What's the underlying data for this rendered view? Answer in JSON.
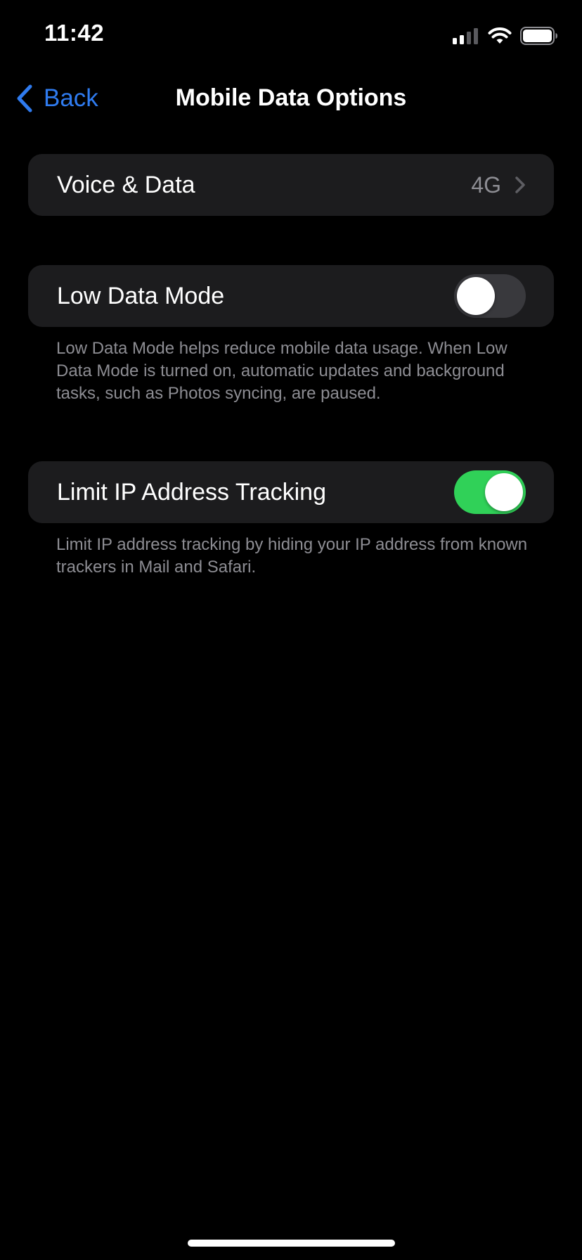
{
  "status_bar": {
    "time": "11:42",
    "icons": [
      "cellular-signal-icon",
      "wifi-icon",
      "battery-icon"
    ]
  },
  "nav": {
    "back_label": "Back",
    "back_icon": "chevron-left-icon",
    "title": "Mobile Data Options"
  },
  "voice_data": {
    "label": "Voice & Data",
    "value": "4G",
    "icon": "chevron-right-icon"
  },
  "low_data_mode": {
    "label": "Low Data Mode",
    "enabled": false,
    "footer": "Low Data Mode helps reduce mobile data usage. When Low Data Mode is turned on, automatic updates and background tasks, such as Photos syncing, are paused."
  },
  "limit_ip": {
    "label": "Limit IP Address Tracking",
    "enabled": true,
    "footer": "Limit IP address tracking by hiding your IP address from known trackers in Mail and Safari."
  },
  "colors": {
    "background": "#000000",
    "group_background": "#1c1c1e",
    "accent_blue": "#2f7bef",
    "toggle_on": "#30d158",
    "toggle_off": "#39393d",
    "secondary_text": "#8d8d93"
  }
}
